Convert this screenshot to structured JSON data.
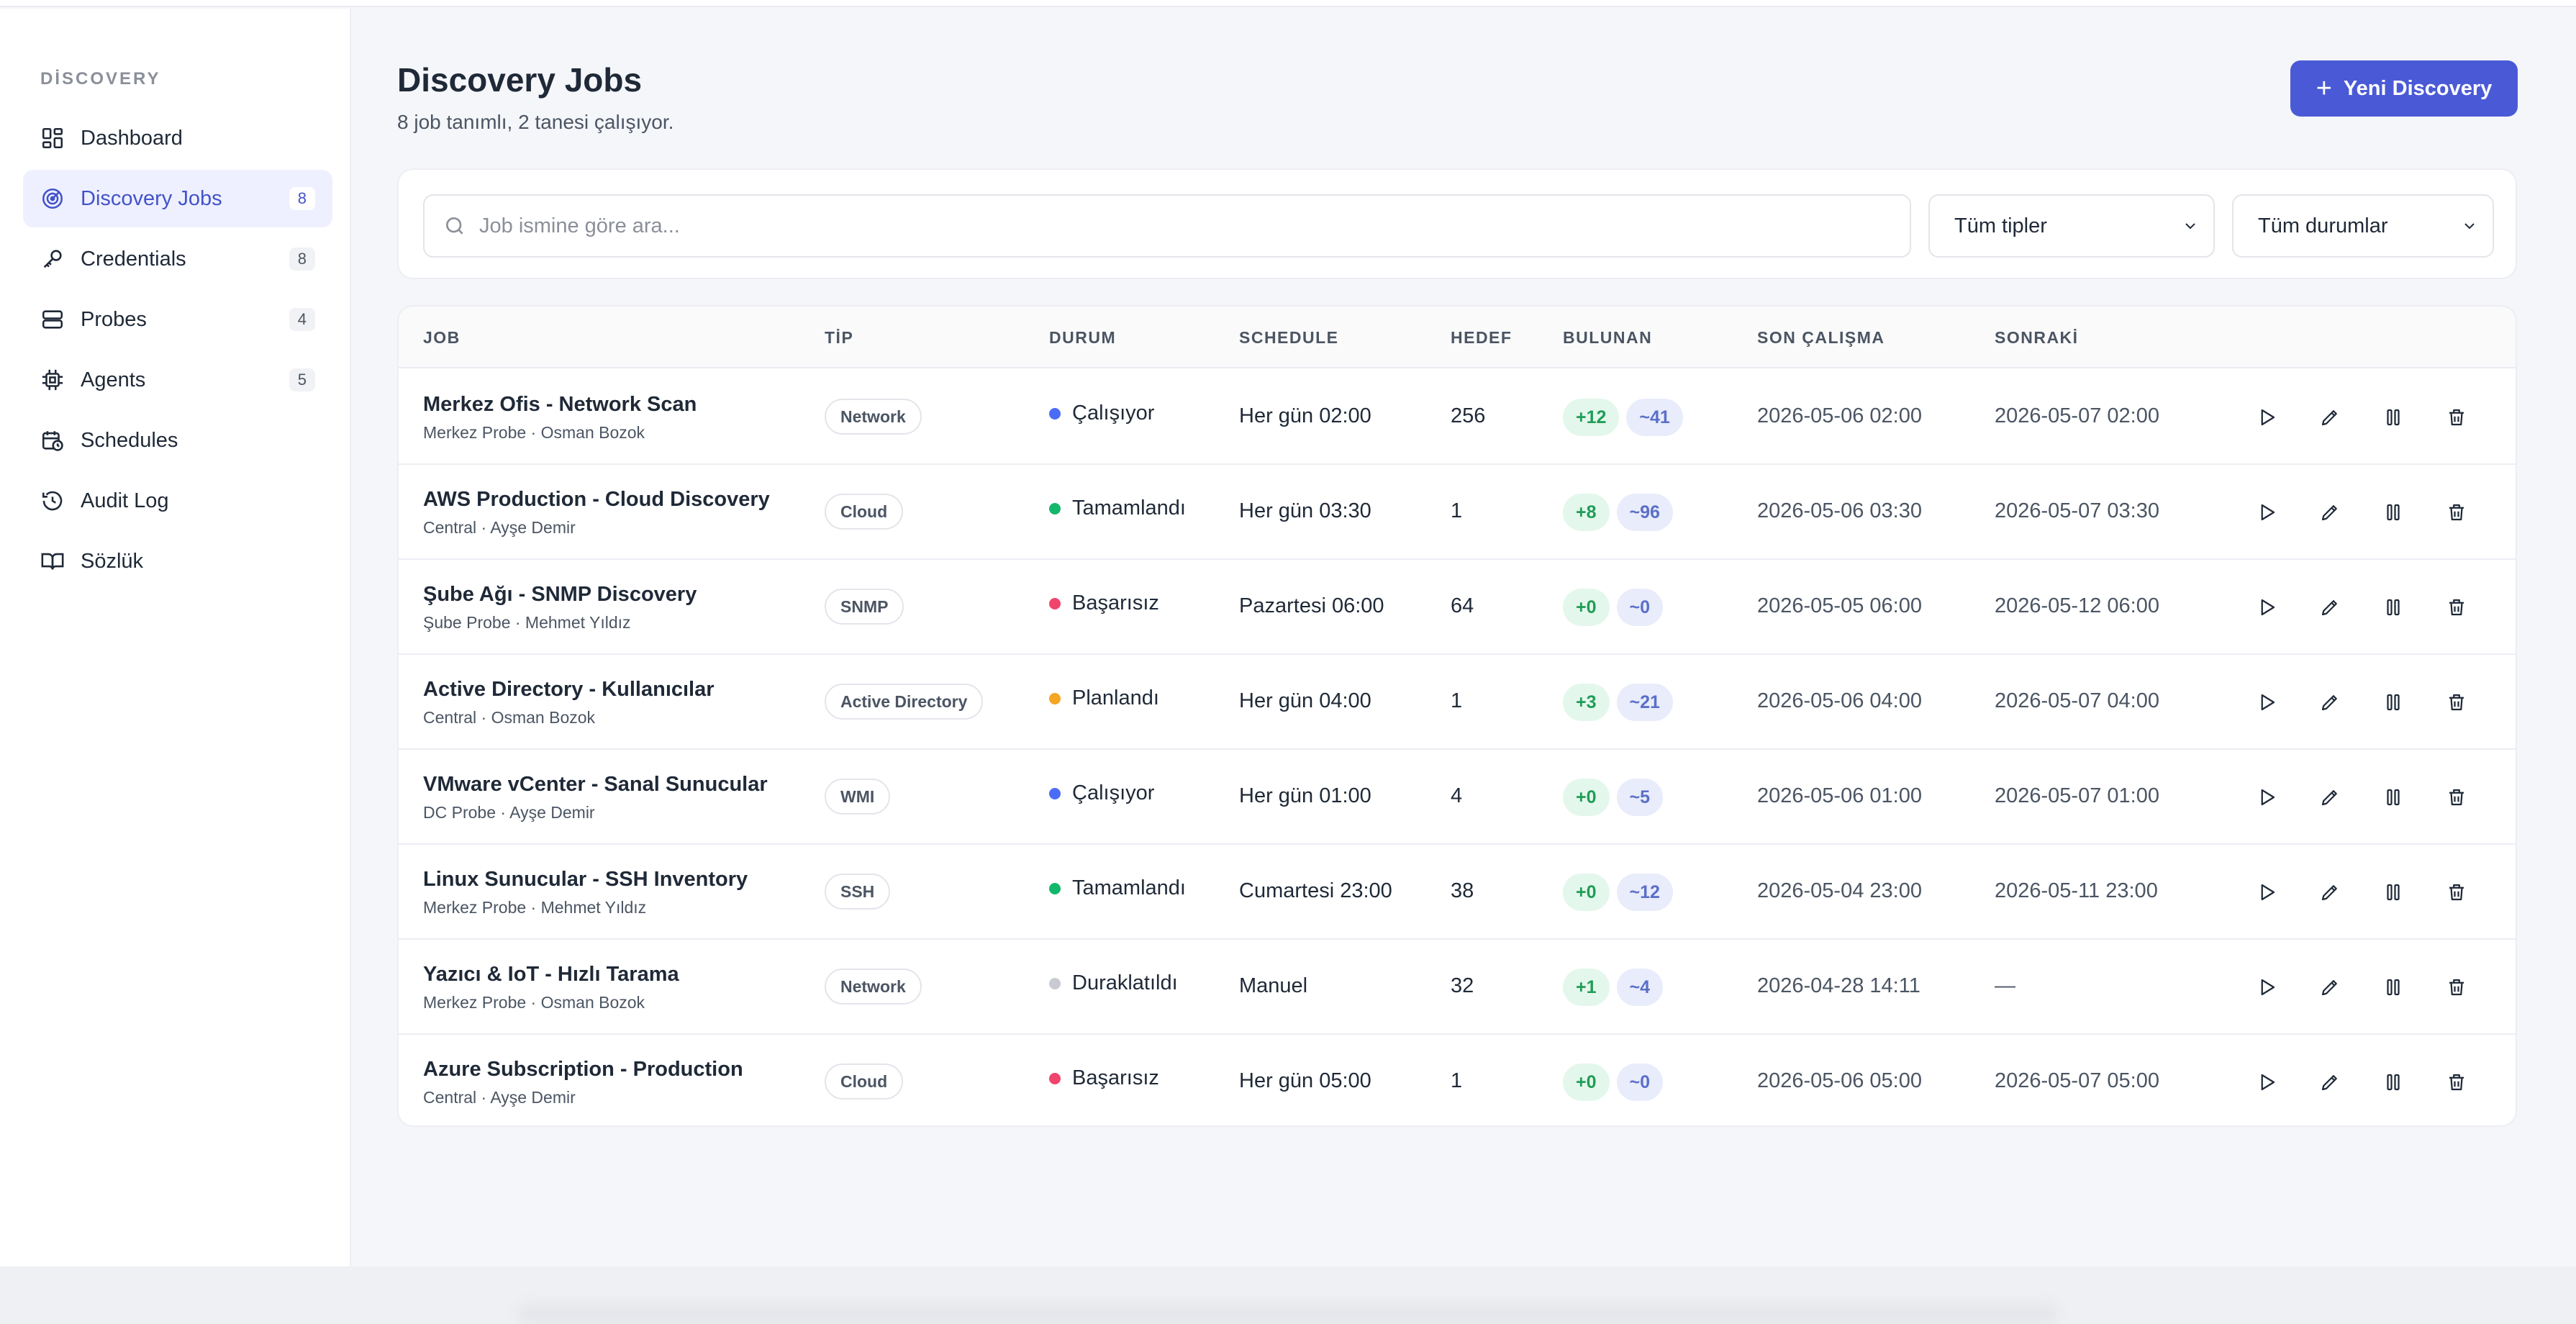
{
  "sidebar": {
    "heading": "DİSCOVERY",
    "items": [
      {
        "label": "Dashboard",
        "icon": "dashboard-icon"
      },
      {
        "label": "Discovery Jobs",
        "count": "8",
        "icon": "radar-icon"
      },
      {
        "label": "Credentials",
        "count": "8",
        "icon": "key-icon"
      },
      {
        "label": "Probes",
        "count": "4",
        "icon": "server-icon"
      },
      {
        "label": "Agents",
        "count": "5",
        "icon": "cpu-icon"
      },
      {
        "label": "Schedules",
        "icon": "calendar-clock-icon"
      },
      {
        "label": "Audit Log",
        "icon": "history-icon"
      },
      {
        "label": "Sözlük",
        "icon": "book-icon"
      }
    ]
  },
  "header": {
    "title": "Discovery Jobs",
    "subtitle": "8 job tanımlı, 2 tanesi çalışıyor.",
    "new_button": "Yeni Discovery"
  },
  "filters": {
    "search_placeholder": "Job ismine göre ara...",
    "type_select": "Tüm tipler",
    "status_select": "Tüm durumlar"
  },
  "table": {
    "columns": {
      "job": "JOB",
      "type": "TİP",
      "status": "DURUM",
      "schedule": "SCHEDULE",
      "target": "HEDEF",
      "found": "BULUNAN",
      "last_run": "SON ÇALIŞMA",
      "next_run": "SONRAKİ"
    },
    "rows": [
      {
        "name": "Merkez Ofis - Network Scan",
        "meta": "Merkez Probe · Osman Bozok",
        "type": "Network",
        "status": "Çalışıyor",
        "status_color": "#4a6cf7",
        "schedule": "Her gün 02:00",
        "target": "256",
        "new": "+12",
        "changed": "~41",
        "last_run": "2026-05-06 02:00",
        "next_run": "2026-05-07 02:00"
      },
      {
        "name": "AWS Production - Cloud Discovery",
        "meta": "Central · Ayşe Demir",
        "type": "Cloud",
        "status": "Tamamlandı",
        "status_color": "#12b76a",
        "schedule": "Her gün 03:30",
        "target": "1",
        "new": "+8",
        "changed": "~96",
        "last_run": "2026-05-06 03:30",
        "next_run": "2026-05-07 03:30"
      },
      {
        "name": "Şube Ağı - SNMP Discovery",
        "meta": "Şube Probe · Mehmet Yıldız",
        "type": "SNMP",
        "status": "Başarısız",
        "status_color": "#f0446c",
        "schedule": "Pazartesi 06:00",
        "target": "64",
        "new": "+0",
        "changed": "~0",
        "last_run": "2026-05-05 06:00",
        "next_run": "2026-05-12 06:00"
      },
      {
        "name": "Active Directory - Kullanıcılar",
        "meta": "Central · Osman Bozok",
        "type": "Active Directory",
        "status": "Planlandı",
        "status_color": "#f5a623",
        "schedule": "Her gün 04:00",
        "target": "1",
        "new": "+3",
        "changed": "~21",
        "last_run": "2026-05-06 04:00",
        "next_run": "2026-05-07 04:00"
      },
      {
        "name": "VMware vCenter - Sanal Sunucular",
        "meta": "DC Probe · Ayşe Demir",
        "type": "WMI",
        "status": "Çalışıyor",
        "status_color": "#4a6cf7",
        "schedule": "Her gün 01:00",
        "target": "4",
        "new": "+0",
        "changed": "~5",
        "last_run": "2026-05-06 01:00",
        "next_run": "2026-05-07 01:00"
      },
      {
        "name": "Linux Sunucular - SSH Inventory",
        "meta": "Merkez Probe · Mehmet Yıldız",
        "type": "SSH",
        "status": "Tamamlandı",
        "status_color": "#12b76a",
        "schedule": "Cumartesi 23:00",
        "target": "38",
        "new": "+0",
        "changed": "~12",
        "last_run": "2026-05-04 23:00",
        "next_run": "2026-05-11 23:00"
      },
      {
        "name": "Yazıcı & IoT - Hızlı Tarama",
        "meta": "Merkez Probe · Osman Bozok",
        "type": "Network",
        "status": "Duraklatıldı",
        "status_color": "#c8cbd2",
        "schedule": "Manuel",
        "target": "32",
        "new": "+1",
        "changed": "~4",
        "last_run": "2026-04-28 14:11",
        "next_run": "—"
      },
      {
        "name": "Azure Subscription - Production",
        "meta": "Central · Ayşe Demir",
        "type": "Cloud",
        "status": "Başarısız",
        "status_color": "#f0446c",
        "schedule": "Her gün 05:00",
        "target": "1",
        "new": "+0",
        "changed": "~0",
        "last_run": "2026-05-06 05:00",
        "next_run": "2026-05-07 05:00"
      }
    ]
  },
  "colors": {
    "accent": "#4a5ad6",
    "active_nav_bg": "#eef0ff",
    "running": "#4a6cf7",
    "completed": "#12b76a",
    "failed": "#f0446c",
    "planned": "#f5a623",
    "paused": "#c8cbd2"
  }
}
